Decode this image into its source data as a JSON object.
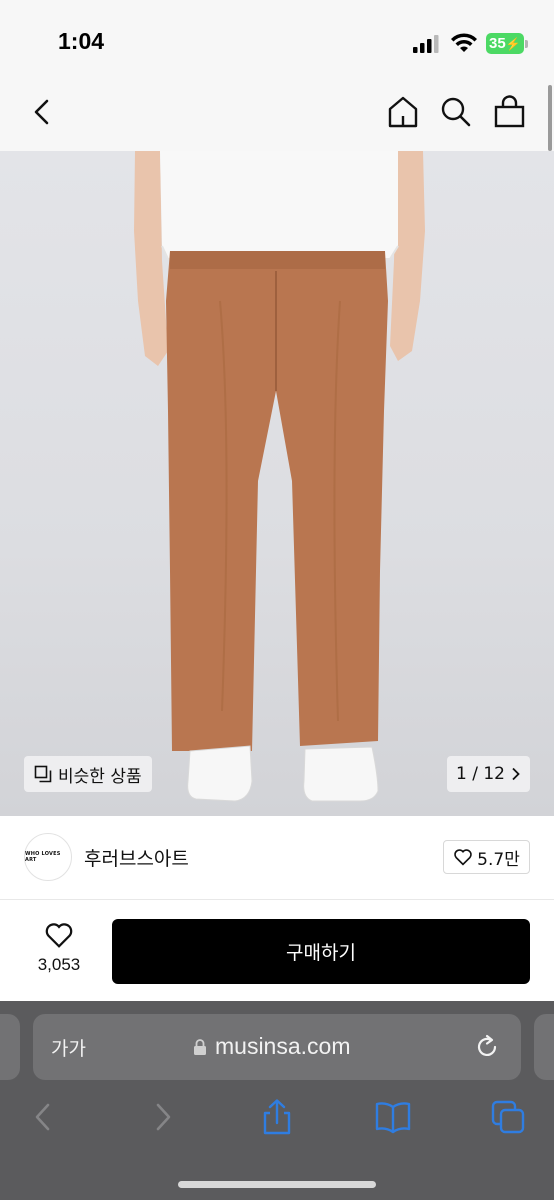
{
  "status": {
    "time": "1:04",
    "battery": "35"
  },
  "header": {
    "back_icon": "chevron-left-icon",
    "home_icon": "home-icon",
    "search_icon": "search-icon",
    "cart_icon": "shopping-bag-icon"
  },
  "gallery": {
    "similar_label": "비슷한 상품",
    "counter": "1 / 12"
  },
  "brand": {
    "logo_text": "WHO LOVES ART",
    "name": "후러브스아트",
    "likes": "5.7만"
  },
  "purchase": {
    "wish_count": "3,053",
    "buy_label": "구매하기"
  },
  "browser": {
    "aa_label": "가가",
    "url": "musinsa.com"
  },
  "colors": {
    "buy_button": "#000000",
    "battery": "#4cd964",
    "browser_tint": "#2f7de1"
  }
}
